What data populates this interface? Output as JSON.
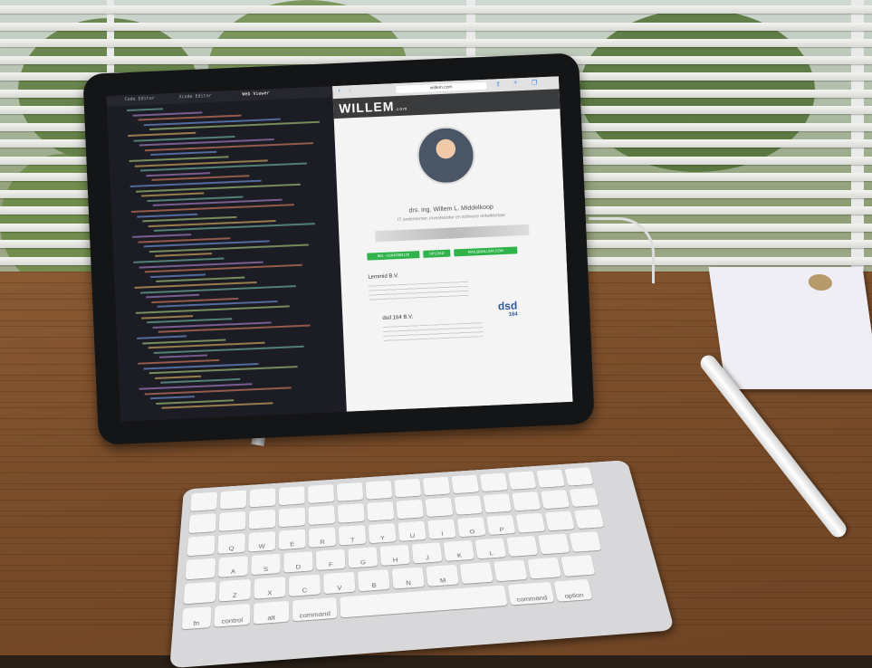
{
  "ipad": {
    "code_tabs": [
      "Code Editor",
      "Xcode Editor",
      "Web Viewer"
    ],
    "browser_url": "willem.com",
    "site_logo": "WILLEM",
    "site_logo_suffix": ".com",
    "person_name": "drs. ing. Willem L. Middelkoop",
    "person_tagline": "IT ondernemer, investeerder en software ontwikkelaar",
    "buttons": [
      "BEL +31645063120",
      "UPLOAD",
      "MAIL@WILLEM.COM"
    ],
    "section_1_title": "Lemmid B.V.",
    "section_2_title": "dsd 164 B.V.",
    "section_2_logo": "dsd",
    "section_2_logo_sub": "164"
  },
  "keyboard": {
    "labels": [
      "command",
      "option",
      "control",
      "alt",
      "fn",
      "Q",
      "W",
      "E",
      "R",
      "T",
      "Y",
      "U",
      "I",
      "O",
      "P",
      "A",
      "S",
      "D",
      "F",
      "G",
      "H",
      "J",
      "K",
      "L",
      "Z",
      "X",
      "C",
      "V",
      "B",
      "N",
      "M"
    ]
  }
}
